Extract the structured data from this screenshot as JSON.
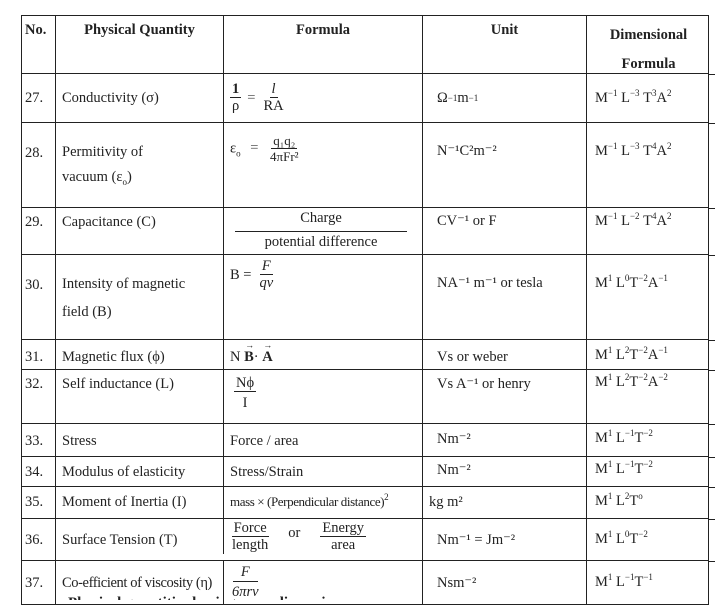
{
  "table": {
    "headers": {
      "no": "No.",
      "quantity": "Physical Quantity",
      "formula": "Formula",
      "unit": "Unit",
      "dimensional_line1": "Dimensional",
      "dimensional_line2": "Formula"
    },
    "rows": [
      {
        "no": "27.",
        "quantity": "Conductivity (σ)",
        "formula": {
          "lhs_num": "1",
          "lhs_den": "ρ",
          "eq": "=",
          "rhs_num": "l",
          "rhs_den": "RA"
        },
        "unit": {
          "base": "Ω",
          "exp1": "−1",
          "base2": "m",
          "exp2": "−1"
        },
        "dim": {
          "M": "−1",
          "L": "−3",
          "T": "3",
          "A": "2"
        }
      },
      {
        "no": "28.",
        "quantity_line1": "Permitivity of",
        "quantity_line2": "vacuum (ε",
        "quantity_sub": "o",
        "quantity_close": ")",
        "formula": {
          "lhs": "ε",
          "lhs_sub": "o",
          "eq": "=",
          "num": "q₁q₂",
          "den": "4πFr²"
        },
        "unit": "N⁻¹C²m⁻²",
        "dim": {
          "M": "−1",
          "L": "−3",
          "T": "4",
          "A": "2"
        }
      },
      {
        "no": "29.",
        "quantity": "Capacitance (C)",
        "formula": {
          "num": "Charge",
          "den": "potential difference"
        },
        "unit": "CV⁻¹  or F",
        "dim": {
          "M": "−1",
          "L": "−2",
          "T": "4",
          "A": "2"
        }
      },
      {
        "no": "30.",
        "quantity_line1": "Intensity of magnetic",
        "quantity_line2": "field (B)",
        "formula": {
          "lhs": "B =",
          "num": "F",
          "den": "qv"
        },
        "unit": "NA⁻¹ m⁻¹ or tesla",
        "dim": {
          "M": "1",
          "L": "0",
          "T": "−2",
          "A": "−1"
        }
      },
      {
        "no": "31.",
        "quantity": "Magnetic flux  (ϕ)",
        "formula": {
          "prefix": "N",
          "v1": "B",
          "dot": "·",
          "v2": "A"
        },
        "unit": "Vs or weber",
        "dim": {
          "M": "1",
          "L": "2",
          "T": "−2",
          "A": "−1"
        }
      },
      {
        "no": "32.",
        "quantity": "Self inductance (L)",
        "formula": {
          "num": "Nϕ",
          "den": "I"
        },
        "unit": "Vs A⁻¹  or henry",
        "dim": {
          "M": "1",
          "L": "2",
          "T": "−2",
          "A": "−2"
        }
      },
      {
        "no": "33.",
        "quantity": "Stress",
        "formula": "Force / area",
        "unit": "Nm⁻²",
        "dim": {
          "M": "1",
          "L": "−1",
          "T": "−2"
        }
      },
      {
        "no": "34.",
        "quantity": "Modulus of elasticity",
        "formula": "Stress/Strain",
        "unit": "Nm⁻²",
        "dim": {
          "M": "1",
          "L": "−1",
          "T": "−2"
        }
      },
      {
        "no": "35.",
        "quantity": "Moment of Inertia (I)",
        "formula": {
          "text": "mass × (Perpendicular distance)",
          "exp": "2"
        },
        "unit": "kg m²",
        "dim": {
          "M": "1",
          "L": "2",
          "T": "o"
        }
      },
      {
        "no": "36.",
        "quantity": "Surface Tension (T)",
        "formula": {
          "num1": "Force",
          "den1": "length",
          "or": "or",
          "num2": "Energy",
          "den2": "area"
        },
        "unit": "Nm⁻¹ = Jm⁻²",
        "dim": {
          "M": "1",
          "L": "0",
          "T": "−2"
        }
      },
      {
        "no": "37.",
        "quantity": "Co-efficient of viscosity (η)",
        "formula": {
          "num": "F",
          "den": "6πrv"
        },
        "unit": "Nsm⁻²",
        "dim": {
          "M": "1",
          "L": "−1",
          "T": "−1"
        }
      }
    ]
  },
  "footer": {
    "partial_text": "Physical quantities having same dimensions"
  }
}
